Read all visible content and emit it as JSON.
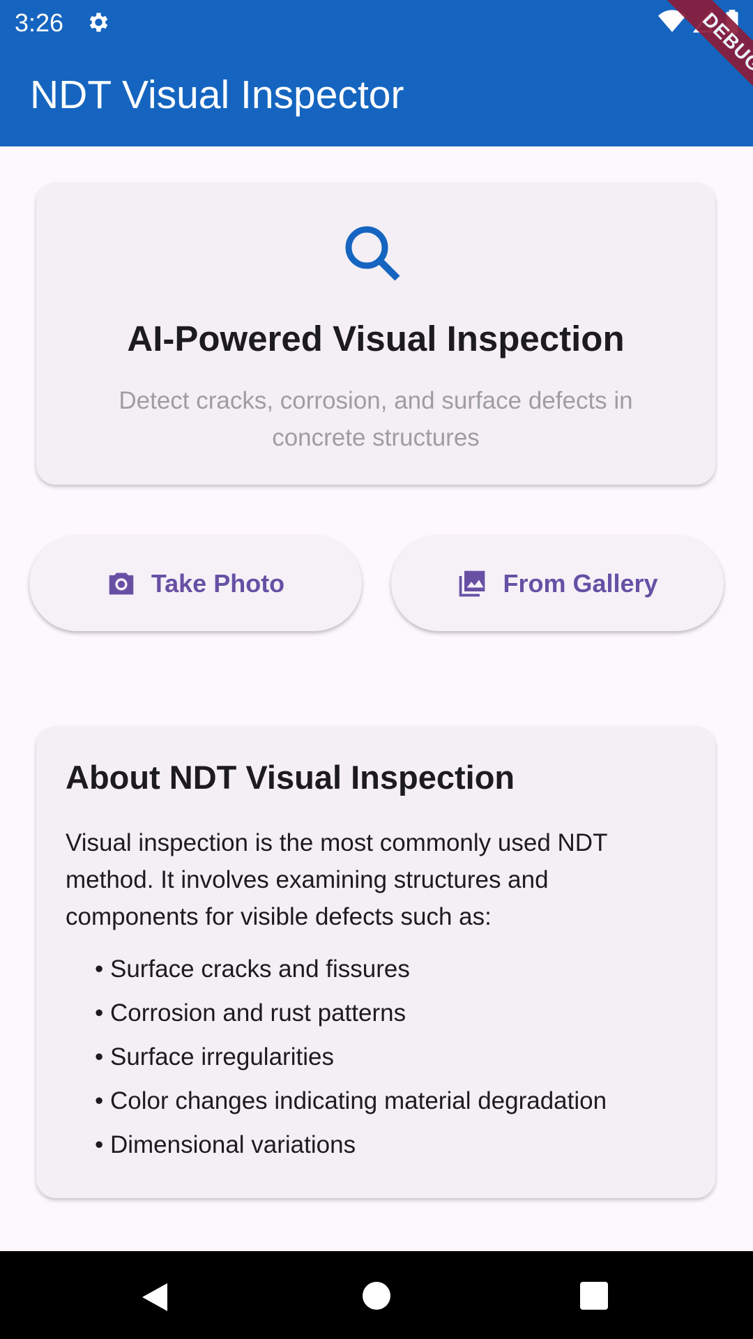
{
  "status_bar": {
    "time": "3:26"
  },
  "app_bar": {
    "title": "NDT Visual Inspector",
    "debug_label": "DEBUG"
  },
  "hero_card": {
    "icon": "search-icon",
    "title": "AI-Powered Visual Inspection",
    "subtitle": "Detect cracks, corrosion, and surface defects in concrete structures"
  },
  "actions": {
    "take_photo": {
      "label": "Take Photo",
      "icon": "camera-icon"
    },
    "from_gallery": {
      "label": "From Gallery",
      "icon": "gallery-icon"
    }
  },
  "about_card": {
    "title": "About NDT Visual Inspection",
    "body": "Visual inspection is the most commonly used NDT method. It involves examining structures and components for visible defects such as:",
    "bullets": [
      "• Surface cracks and fissures",
      "• Corrosion and rust patterns",
      "• Surface irregularities",
      "• Color changes indicating material degradation",
      "• Dimensional variations"
    ]
  },
  "colors": {
    "app_bar": "#1565c0",
    "accent": "#6750a4",
    "background": "#fdf7fe",
    "card": "#f4eff5"
  }
}
